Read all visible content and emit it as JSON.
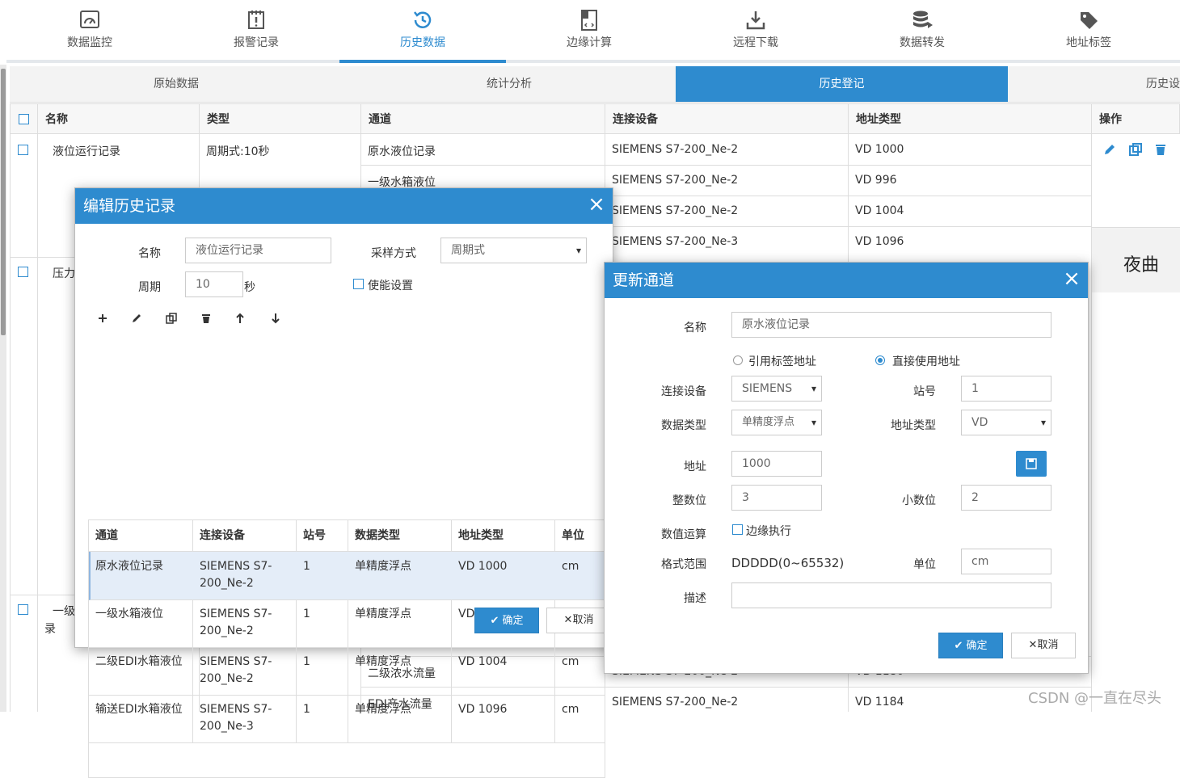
{
  "nav": {
    "items": [
      {
        "label": "数据监控",
        "icon": "gauge-icon"
      },
      {
        "label": "报警记录",
        "icon": "alarm-icon"
      },
      {
        "label": "历史数据",
        "icon": "history-icon"
      },
      {
        "label": "边缘计算",
        "icon": "code-file-icon"
      },
      {
        "label": "远程下载",
        "icon": "download-icon"
      },
      {
        "label": "数据转发",
        "icon": "database-forward-icon"
      },
      {
        "label": "地址标签",
        "icon": "tag-icon"
      }
    ],
    "active_index": 2
  },
  "subtabs": [
    "原始数据",
    "统计分析",
    "历史登记",
    "历史设"
  ],
  "subtab_active": "历史登记",
  "table": {
    "headers": [
      "名称",
      "类型",
      "通道",
      "连接设备",
      "地址类型",
      "操作"
    ],
    "rows": [
      {
        "name": "液位运行记录",
        "type": "周期式:10秒"
      },
      {
        "name": "压力"
      },
      {
        "name": "一级",
        "name2": "录"
      }
    ],
    "channels": [
      {
        "channel": "原水液位记录",
        "device": "SIEMENS S7-200_Ne-2",
        "addr": "VD 1000"
      },
      {
        "channel": "一级水箱液位",
        "device": "SIEMENS S7-200_Ne-2",
        "addr": "VD 996"
      },
      {
        "channel": "",
        "device": "SIEMENS S7-200_Ne-2",
        "addr": "VD 1004"
      },
      {
        "channel": "",
        "device": "SIEMENS S7-200_Ne-3",
        "addr": "VD 1096"
      },
      {
        "channel": "二级浓水流量",
        "device": "SIEMENS S7-200_Ne-2",
        "addr": "VD 1180"
      },
      {
        "channel": "EDI产水流量",
        "device": "SIEMENS S7-200_Ne-2",
        "addr": "VD 1184"
      }
    ]
  },
  "right_panel_text": "夜曲",
  "watermark": "CSDN @一直在尽头",
  "edit_dialog": {
    "title": "编辑历史记录",
    "name_label": "名称",
    "name_value": "液位运行记录",
    "sampling_label": "采样方式",
    "sampling_value": "周期式",
    "period_label": "周期",
    "period_value": "10",
    "period_unit": "秒",
    "enable_label": "使能设置",
    "table_headers": [
      "通道",
      "连接设备",
      "站号",
      "数据类型",
      "地址类型",
      "单位"
    ],
    "rows": [
      {
        "channel": "原水液位记录",
        "device": "SIEMENS S7-200_Ne-2",
        "station": "1",
        "dtype": "单精度浮点",
        "addr": "VD 1000",
        "unit": "cm"
      },
      {
        "channel": "一级水箱液位",
        "device": "SIEMENS S7-200_Ne-2",
        "station": "1",
        "dtype": "单精度浮点",
        "addr": "VD 996",
        "unit": "cm"
      },
      {
        "channel": "二级EDI水箱液位",
        "device": "SIEMENS S7-200_Ne-2",
        "station": "1",
        "dtype": "单精度浮点",
        "addr": "VD 1004",
        "unit": "cm"
      },
      {
        "channel": "输送EDI水箱液位",
        "device": "SIEMENS S7-200_Ne-3",
        "station": "1",
        "dtype": "单精度浮点",
        "addr": "VD 1096",
        "unit": "cm"
      }
    ],
    "ok_label": "确定",
    "cancel_label": "取消"
  },
  "update_dialog": {
    "title": "更新通道",
    "name_label": "名称",
    "name_value": "原水液位记录",
    "radio_tag": "引用标签地址",
    "radio_direct": "直接使用地址",
    "device_label": "连接设备",
    "device_value": "SIEMENS",
    "station_label": "站号",
    "station_value": "1",
    "dtype_label": "数据类型",
    "dtype_value": "单精度浮点",
    "addrtype_label": "地址类型",
    "addrtype_value": "VD",
    "addr_label": "地址",
    "addr_value": "1000",
    "int_label": "整数位",
    "int_value": "3",
    "dec_label": "小数位",
    "dec_value": "2",
    "calc_label": "数值运算",
    "edge_label": "边缘执行",
    "format_label": "格式范围",
    "format_value": "DDDDD(0~65532)",
    "unit_label": "单位",
    "unit_value": "cm",
    "desc_label": "描述",
    "desc_value": "",
    "ok_label": "确定",
    "cancel_label": "取消"
  },
  "colors": {
    "primary": "#2e8bcf"
  }
}
